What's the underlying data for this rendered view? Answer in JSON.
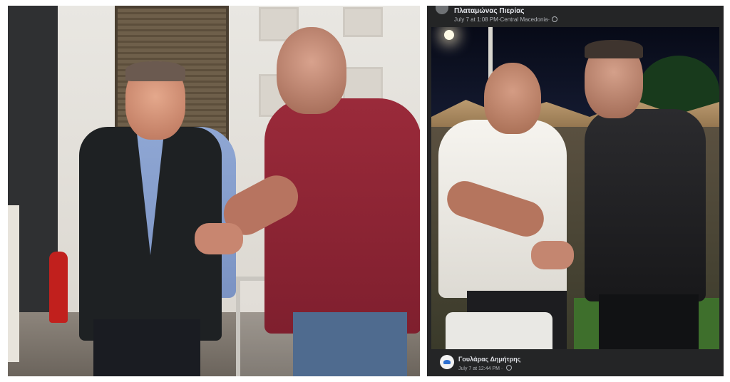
{
  "left_photo": {
    "alt": ""
  },
  "right_post": {
    "top": {
      "page_name": "Πλαταμώνας Πιερίας",
      "date": "July 7 at 1:08 PM",
      "separator": " · ",
      "location": "Central Macedonia",
      "privacy_icon": "globe-icon"
    },
    "bottom": {
      "author": "Γουλάρας Δημήτρης",
      "date": "July 7 at 12:44 PM",
      "separator": " · ",
      "privacy_icon": "globe-icon"
    }
  },
  "colors": {
    "post_background": "#242526",
    "primary_text": "#e4e6eb",
    "secondary_text": "#b0b3b8"
  }
}
